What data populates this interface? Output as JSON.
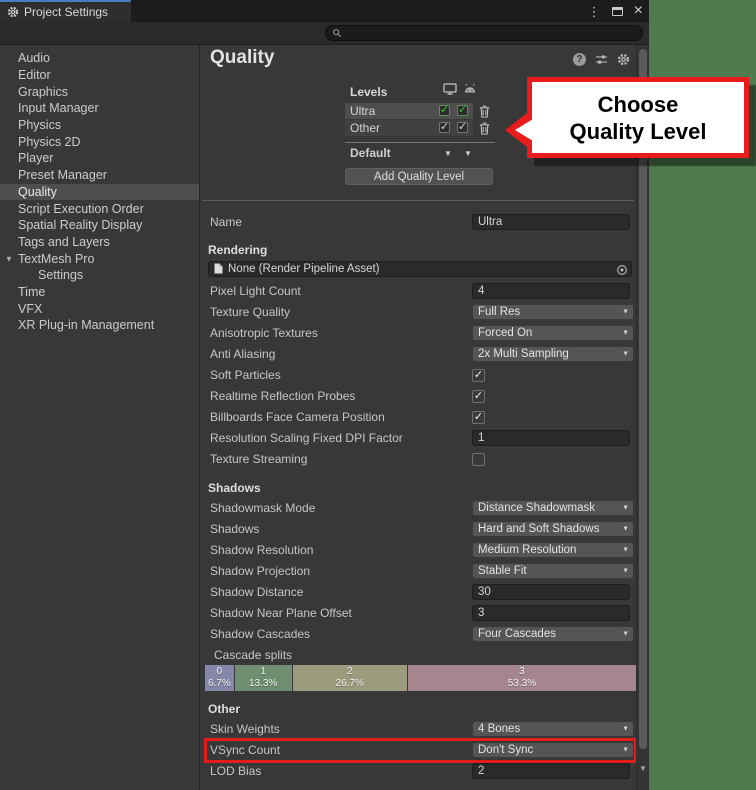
{
  "window": {
    "tab_title": "Project Settings"
  },
  "toolbar": {
    "search_value": "",
    "search_placeholder": ""
  },
  "glyphs": {
    "check": "✓",
    "caret": "▼",
    "kebab": "⋮",
    "close": "×",
    "help": "?",
    "foldout": "▼"
  },
  "sidebar": {
    "items": [
      {
        "label": "Audio"
      },
      {
        "label": "Editor"
      },
      {
        "label": "Graphics"
      },
      {
        "label": "Input Manager"
      },
      {
        "label": "Physics"
      },
      {
        "label": "Physics 2D"
      },
      {
        "label": "Player"
      },
      {
        "label": "Preset Manager"
      },
      {
        "label": "Quality",
        "selected": true
      },
      {
        "label": "Script Execution Order"
      },
      {
        "label": "Spatial Reality Display"
      },
      {
        "label": "Tags and Layers"
      },
      {
        "label": "TextMesh Pro",
        "foldout": true
      },
      {
        "label": "Settings",
        "indent": true
      },
      {
        "label": "Time"
      },
      {
        "label": "VFX"
      },
      {
        "label": "XR Plug-in Management"
      }
    ]
  },
  "content": {
    "title": "Quality",
    "levels": {
      "header": "Levels",
      "platforms": [
        "desktop",
        "android"
      ],
      "rows": [
        {
          "name": "Ultra",
          "checks": [
            true,
            true
          ],
          "style": "green",
          "selected": true
        },
        {
          "name": "Other",
          "checks": [
            true,
            true
          ],
          "style": "plain",
          "selected": false
        }
      ],
      "default_label": "Default",
      "add_button": "Add Quality Level"
    },
    "sections": [
      {
        "rows": [
          {
            "label": "Name",
            "type": "text",
            "value": "Ultra"
          }
        ]
      },
      {
        "header": "Rendering",
        "rows": [
          {
            "type": "object",
            "value": "None (Render Pipeline Asset)"
          },
          {
            "label": "Pixel Light Count",
            "type": "text",
            "value": "4"
          },
          {
            "label": "Texture Quality",
            "type": "dropdown",
            "value": "Full Res"
          },
          {
            "label": "Anisotropic Textures",
            "type": "dropdown",
            "value": "Forced On"
          },
          {
            "label": "Anti Aliasing",
            "type": "dropdown",
            "value": "2x Multi Sampling"
          },
          {
            "label": "Soft Particles",
            "type": "checkbox",
            "value": true
          },
          {
            "label": "Realtime Reflection Probes",
            "type": "checkbox",
            "value": true
          },
          {
            "label": "Billboards Face Camera Position",
            "type": "checkbox",
            "value": true
          },
          {
            "label": "Resolution Scaling Fixed DPI Factor",
            "type": "text",
            "value": "1"
          },
          {
            "label": "Texture Streaming",
            "type": "checkbox",
            "value": false
          }
        ]
      },
      {
        "header": "Shadows",
        "rows": [
          {
            "label": "Shadowmask Mode",
            "type": "dropdown",
            "value": "Distance Shadowmask"
          },
          {
            "label": "Shadows",
            "type": "dropdown",
            "value": "Hard and Soft Shadows"
          },
          {
            "label": "Shadow Resolution",
            "type": "dropdown",
            "value": "Medium Resolution"
          },
          {
            "label": "Shadow Projection",
            "type": "dropdown",
            "value": "Stable Fit"
          },
          {
            "label": "Shadow Distance",
            "type": "text",
            "value": "30"
          },
          {
            "label": "Shadow Near Plane Offset",
            "type": "text",
            "value": "3"
          },
          {
            "label": "Shadow Cascades",
            "type": "dropdown",
            "value": "Four Cascades"
          },
          {
            "type": "cascade"
          }
        ]
      },
      {
        "header": "Other",
        "rows": [
          {
            "label": "Skin Weights",
            "type": "dropdown",
            "value": "4 Bones"
          },
          {
            "label": "VSync Count",
            "type": "dropdown",
            "value": "Don't Sync",
            "highlight": true
          },
          {
            "label": "LOD Bias",
            "type": "text",
            "value": "2"
          }
        ]
      }
    ],
    "cascade": {
      "label": "Cascade splits",
      "segments": [
        {
          "index": "0",
          "percent": "6.7%",
          "width": 6.7,
          "color": "#8587a8"
        },
        {
          "index": "1",
          "percent": "13.3%",
          "width": 13.3,
          "color": "#6f8f70"
        },
        {
          "index": "2",
          "percent": "26.7%",
          "width": 26.7,
          "color": "#9b9c7d"
        },
        {
          "index": "3",
          "percent": "53.3%",
          "width": 53.3,
          "color": "#a5868f"
        }
      ]
    }
  },
  "callout": {
    "line1": "Choose",
    "line2": "Quality Level",
    "border_color": "#e81c1c",
    "bg": "#ffffff"
  },
  "colors": {
    "accent_red": "#e41c1c",
    "green_background": "#4f7c4e",
    "tab_accent": "#4b7dbd",
    "window_bg": "#383838"
  }
}
